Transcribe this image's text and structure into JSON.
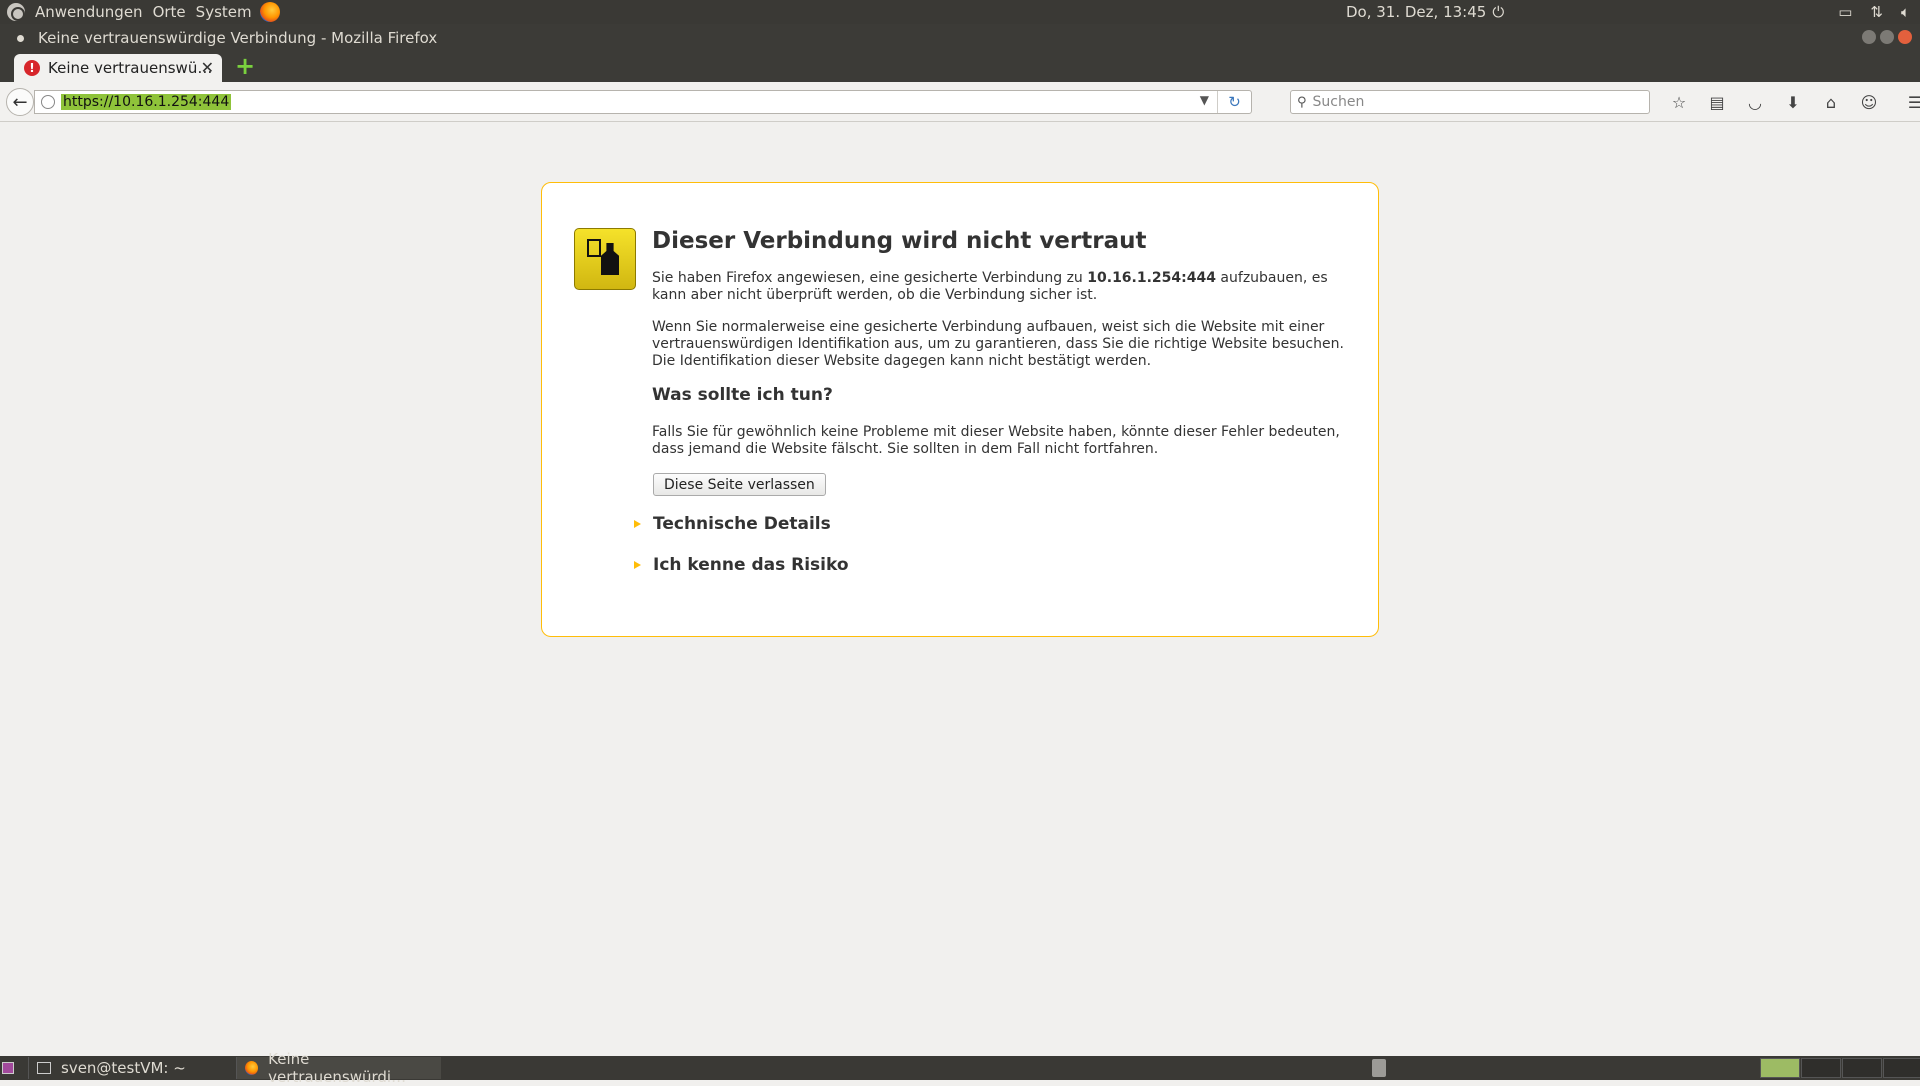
{
  "top_panel": {
    "menus": [
      "Anwendungen",
      "Orte",
      "System"
    ],
    "clock": "Do, 31. Dez, 13:45",
    "icons": [
      "ubuntu-logo",
      "firefox-launcher",
      "power-icon",
      "battery-icon",
      "network-icon",
      "volume-icon"
    ]
  },
  "window": {
    "title": "Keine vertrauenswürdige Verbindung - Mozilla Firefox"
  },
  "tabs": [
    {
      "label": "Keine vertrauenswü…",
      "icon": "error-icon",
      "active": true
    }
  ],
  "nav": {
    "url": "https://10.16.1.254:444",
    "search_placeholder": "Suchen"
  },
  "error_page": {
    "title": "Dieser Verbindung wird nicht vertraut",
    "para1_before": "Sie haben Firefox angewiesen, eine gesicherte Verbindung zu ",
    "para1_host": "10.16.1.254:444",
    "para1_after": " aufzubauen, es kann aber nicht überprüft werden, ob die Verbindung sicher ist.",
    "para2": "Wenn Sie normalerweise eine gesicherte Verbindung aufbauen, weist sich die Website mit einer vertrauenswürdigen Identifikation aus, um zu garantieren, dass Sie die richtige Website besuchen. Die Identifikation dieser Website dagegen kann nicht bestätigt werden.",
    "heading2": "Was sollte ich tun?",
    "para3": "Falls Sie für gewöhnlich keine Probleme mit dieser Website haben, könnte dieser Fehler bedeuten, dass jemand die Website fälscht. Sie sollten in dem Fall nicht fortfahren.",
    "leave_button": "Diese Seite verlassen",
    "expander1": "Technische Details",
    "expander2": "Ich kenne das Risiko"
  },
  "taskbar": {
    "items": [
      {
        "label": "sven@testVM: ~",
        "icon": "terminal-icon"
      },
      {
        "label": "Keine vertrauenswürdi…",
        "icon": "firefox-icon"
      }
    ]
  },
  "colors": {
    "panel": "#3a3935",
    "accent_border": "#ffbd09",
    "url_selection": "#8fc33a"
  }
}
